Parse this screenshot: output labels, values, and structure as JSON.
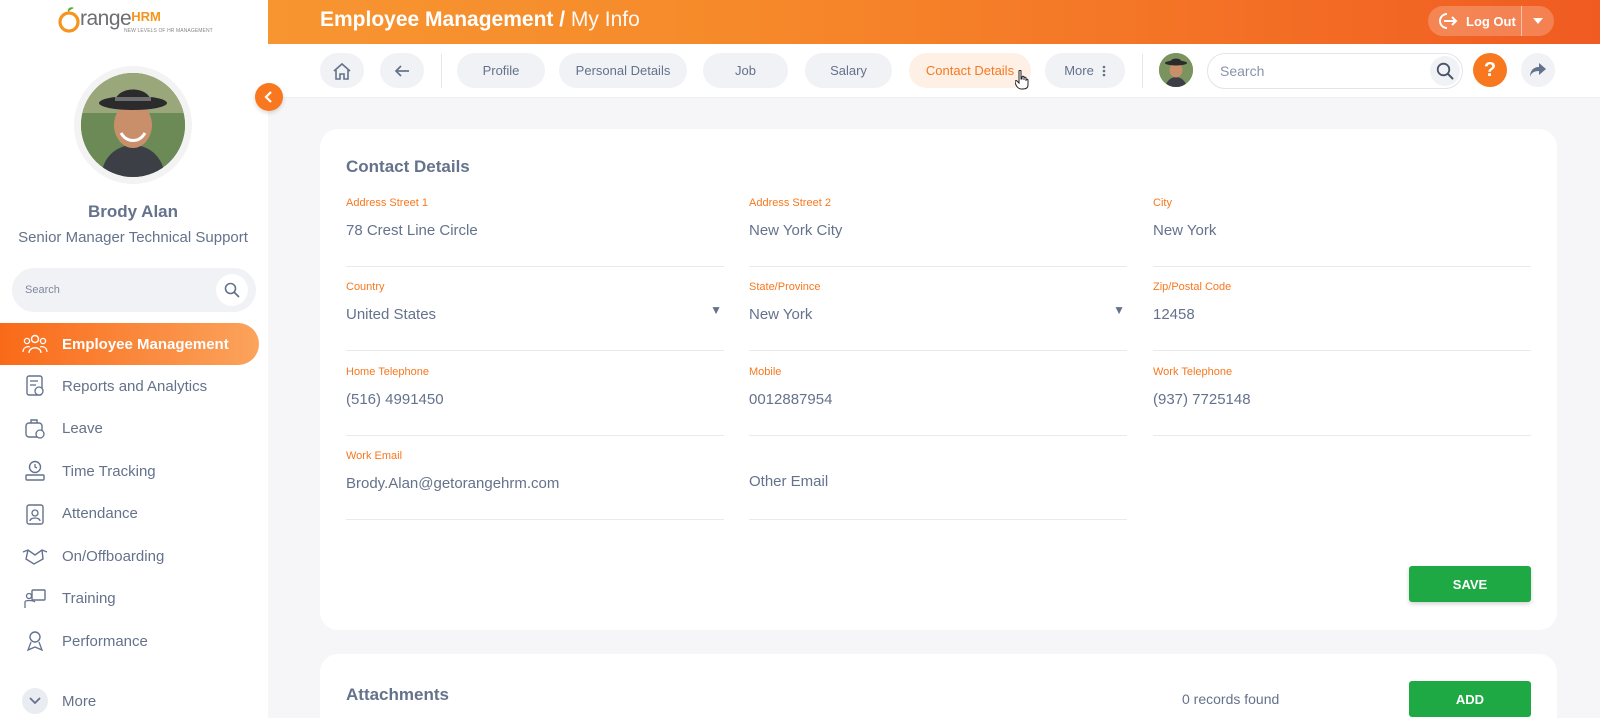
{
  "brand": {
    "logo_main": "range",
    "logo_o": "O",
    "logo_hrm": "HRM",
    "tagline": "NEW LEVELS OF HR MANAGEMENT",
    "accent": "#f7781f",
    "green": "#1ea945"
  },
  "user": {
    "name": "Brody Alan",
    "title": "Senior Manager Technical Support"
  },
  "sidebar": {
    "search_placeholder": "Search",
    "items": [
      {
        "label": "Employee Management",
        "icon": "people-group-icon",
        "active": true
      },
      {
        "label": "Reports and Analytics",
        "icon": "report-icon"
      },
      {
        "label": "Leave",
        "icon": "leave-icon"
      },
      {
        "label": "Time Tracking",
        "icon": "time-tracking-icon"
      },
      {
        "label": "Attendance",
        "icon": "attendance-icon"
      },
      {
        "label": "On/Offboarding",
        "icon": "handshake-icon"
      },
      {
        "label": "Training",
        "icon": "training-icon"
      },
      {
        "label": "Performance",
        "icon": "performance-icon"
      }
    ],
    "more_label": "More"
  },
  "header": {
    "title": "Employee Management",
    "separator": " / ",
    "subtitle": "My Info",
    "logout_label": "Log Out"
  },
  "tabs": {
    "items": [
      {
        "label": "Profile"
      },
      {
        "label": "Personal Details"
      },
      {
        "label": "Job"
      },
      {
        "label": "Salary"
      },
      {
        "label": "Contact Details",
        "active": true
      },
      {
        "label": "More"
      }
    ],
    "search_placeholder": "Search",
    "help_label": "?"
  },
  "contact": {
    "heading": "Contact Details",
    "address1": {
      "label": "Address Street 1",
      "value": "78 Crest Line Circle"
    },
    "address2": {
      "label": "Address Street 2",
      "value": "New York City"
    },
    "city": {
      "label": "City",
      "value": "New York"
    },
    "country": {
      "label": "Country",
      "value": "United States"
    },
    "state": {
      "label": "State/Province",
      "value": "New York"
    },
    "zip": {
      "label": "Zip/Postal Code",
      "value": "12458"
    },
    "home_tel": {
      "label": "Home Telephone",
      "value": "(516) 4991450"
    },
    "mobile": {
      "label": "Mobile",
      "value": "0012887954"
    },
    "work_tel": {
      "label": "Work Telephone",
      "value": "(937) 7725148"
    },
    "work_email": {
      "label": "Work Email",
      "value": "Brody.Alan@getorangehrm.com"
    },
    "other_email": {
      "placeholder": "Other Email"
    },
    "save_label": "SAVE"
  },
  "attachments": {
    "heading": "Attachments",
    "records": "0 records found",
    "add_label": "ADD"
  }
}
